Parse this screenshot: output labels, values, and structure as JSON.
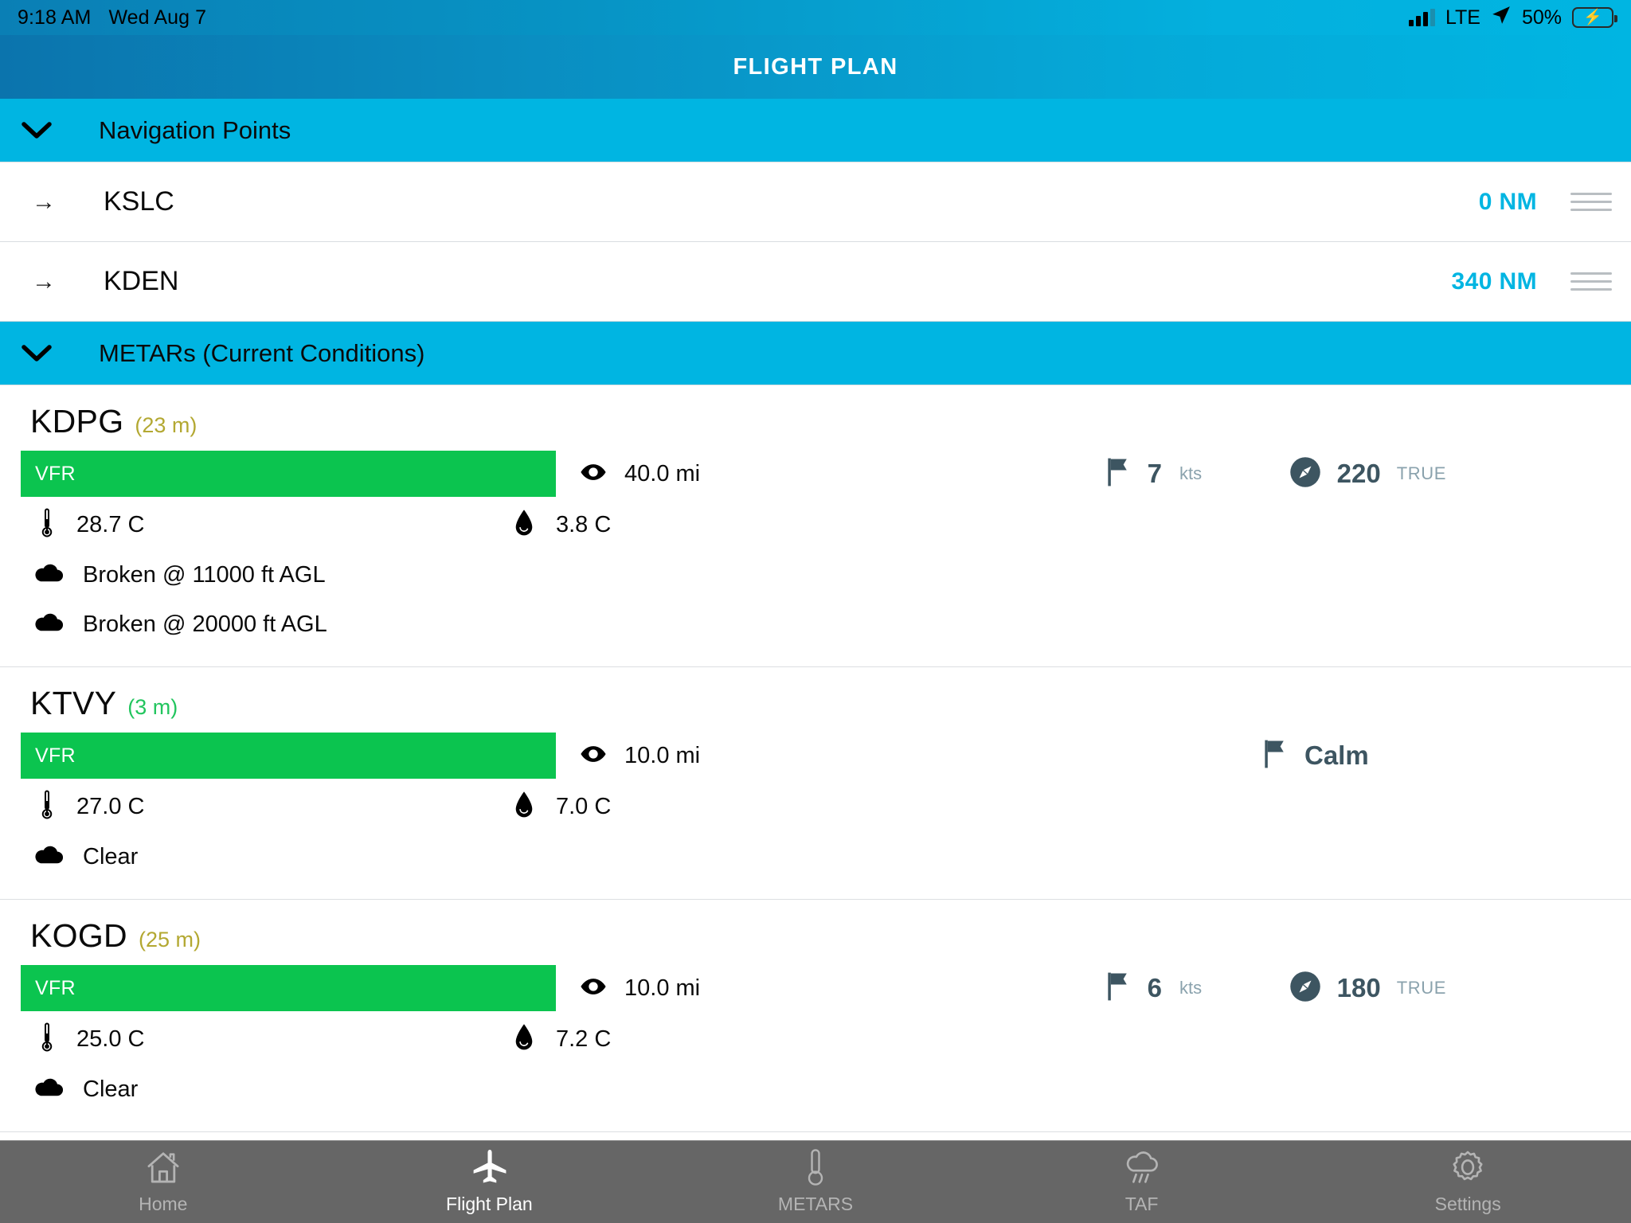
{
  "statusbar": {
    "time": "9:18 AM",
    "date": "Wed Aug 7",
    "network": "LTE",
    "battery_percent": "50%",
    "signal_icon": "signal-bars-icon",
    "location_icon": "location-arrow-icon",
    "battery_icon": "battery-charging-icon"
  },
  "header": {
    "title": "FLIGHT PLAN"
  },
  "colors": {
    "accent_cyan": "#00b5e2",
    "title_blue": "#0a8cc0",
    "vfr_green": "#0bc44f",
    "age_fresh": "#22c55e",
    "age_stale": "#b3a832",
    "wind_slate": "#3d5561",
    "wind_unit": "#8aa2ad",
    "tabbar_gray": "#666666"
  },
  "sections": {
    "nav_points": {
      "label": "Navigation Points",
      "chevron": "chevron-down-icon",
      "rows": [
        {
          "arrow": "arrow-right-icon",
          "name": "KSLC",
          "distance": "0 NM",
          "handle": "drag-handle-icon"
        },
        {
          "arrow": "arrow-right-icon",
          "name": "KDEN",
          "distance": "340 NM",
          "handle": "drag-handle-icon"
        }
      ]
    },
    "metars": {
      "label": "METARs (Current Conditions)",
      "chevron": "chevron-down-icon",
      "stations": [
        {
          "id": "KDPG",
          "age": "(23 m)",
          "age_color": "#b3a832",
          "category": "VFR",
          "category_color": "#0bc44f",
          "visibility": "40.0 mi",
          "wind_speed": "7",
          "wind_unit": "kts",
          "wind_dir": "220",
          "wind_dir_unit": "TRUE",
          "calm": "",
          "temperature": "28.7 C",
          "dewpoint": "3.8 C",
          "clouds": [
            "Broken @ 11000 ft AGL",
            "Broken @ 20000 ft AGL"
          ]
        },
        {
          "id": "KTVY",
          "age": "(3 m)",
          "age_color": "#22c55e",
          "category": "VFR",
          "category_color": "#0bc44f",
          "visibility": "10.0 mi",
          "wind_speed": "",
          "wind_unit": "",
          "wind_dir": "",
          "wind_dir_unit": "",
          "calm": "Calm",
          "temperature": "27.0 C",
          "dewpoint": "7.0 C",
          "clouds": [
            "Clear"
          ]
        },
        {
          "id": "KOGD",
          "age": "(25 m)",
          "age_color": "#b3a832",
          "category": "VFR",
          "category_color": "#0bc44f",
          "visibility": "10.0 mi",
          "wind_speed": "6",
          "wind_unit": "kts",
          "wind_dir": "180",
          "wind_dir_unit": "TRUE",
          "calm": "",
          "temperature": "25.0 C",
          "dewpoint": "7.2 C",
          "clouds": [
            "Clear"
          ]
        }
      ]
    }
  },
  "icons": {
    "visibility": "eye-icon",
    "wind": "flag-icon",
    "direction": "compass-icon",
    "temperature": "thermometer-icon",
    "dewpoint": "droplet-icon",
    "cloud": "cloud-icon"
  },
  "tabbar": {
    "tabs": [
      {
        "label": "Home",
        "icon": "home-icon",
        "active": false
      },
      {
        "label": "Flight Plan",
        "icon": "airplane-icon",
        "active": true
      },
      {
        "label": "METARS",
        "icon": "thermometer-icon",
        "active": false
      },
      {
        "label": "TAF",
        "icon": "rain-cloud-icon",
        "active": false
      },
      {
        "label": "Settings",
        "icon": "gear-icon",
        "active": false
      }
    ]
  }
}
